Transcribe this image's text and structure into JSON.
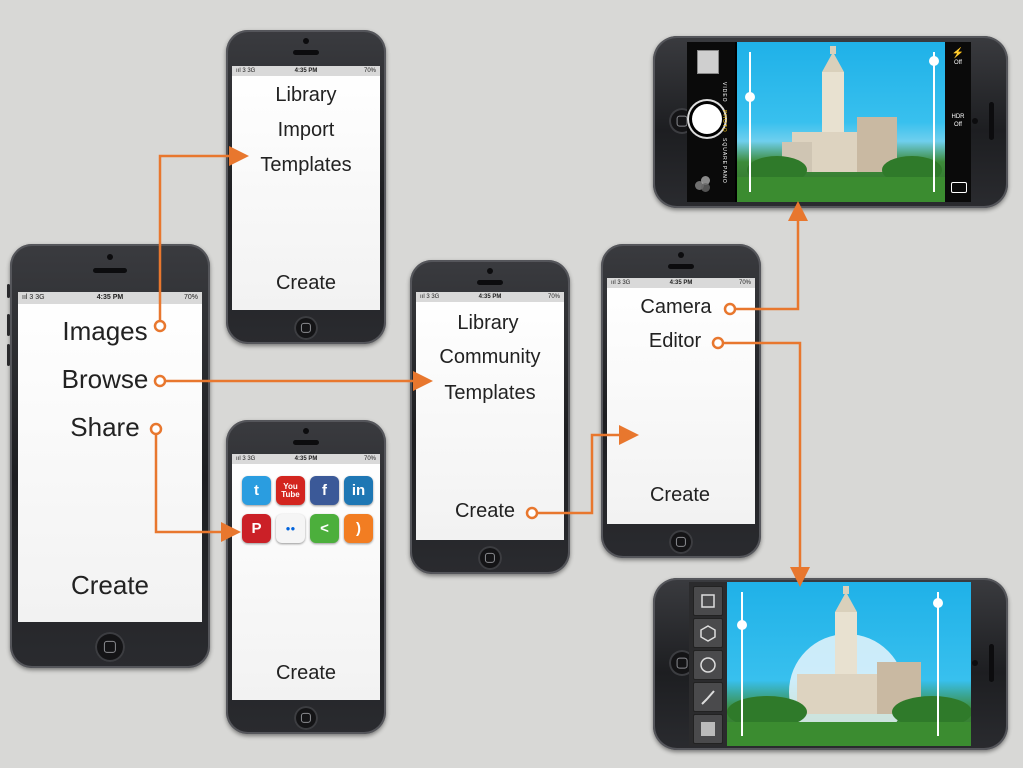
{
  "status_bar": {
    "signal": "ııl 3  3G",
    "time": "4:35 PM",
    "battery": "70%"
  },
  "main_phone": {
    "items": [
      "Images",
      "Browse",
      "Share"
    ],
    "create": "Create"
  },
  "images_phone": {
    "items": [
      "Library",
      "Import",
      "Templates"
    ],
    "create": "Create"
  },
  "share_phone": {
    "social_icons": [
      {
        "name": "twitter-icon",
        "glyph": "t",
        "color": "#2a9de0"
      },
      {
        "name": "youtube-icon",
        "glyph": "You\nTube",
        "color": "#d3251f"
      },
      {
        "name": "facebook-icon",
        "glyph": "f",
        "color": "#3b5998"
      },
      {
        "name": "linkedin-icon",
        "glyph": "in",
        "color": "#1e77b4"
      },
      {
        "name": "pinterest-icon",
        "glyph": "P",
        "color": "#cb2027"
      },
      {
        "name": "flickr-icon",
        "glyph": "●●",
        "color": "#f5f5f5"
      },
      {
        "name": "share-icon",
        "glyph": "<",
        "color": "#4caf3c"
      },
      {
        "name": "rss-icon",
        "glyph": ")",
        "color": "#f27d22"
      }
    ],
    "create": "Create"
  },
  "browse_phone": {
    "items": [
      "Library",
      "Community",
      "Templates"
    ],
    "create": "Create"
  },
  "create_phone": {
    "items": [
      "Camera",
      "Editor"
    ],
    "create": "Create"
  },
  "camera_phone": {
    "modes": [
      "VIDEO",
      "PHOTO",
      "SQUARE",
      "PANO"
    ],
    "flash": "Off",
    "hdr_label": "HDR",
    "hdr_value": "Off"
  },
  "editor_phone": {
    "tools": [
      "square-tool-icon",
      "hexagon-tool-icon",
      "circle-tool-icon",
      "brush-tool-icon",
      "gradient-tool-icon"
    ]
  },
  "colors": {
    "arrow": "#e8772e",
    "background": "#d8d8d6"
  }
}
